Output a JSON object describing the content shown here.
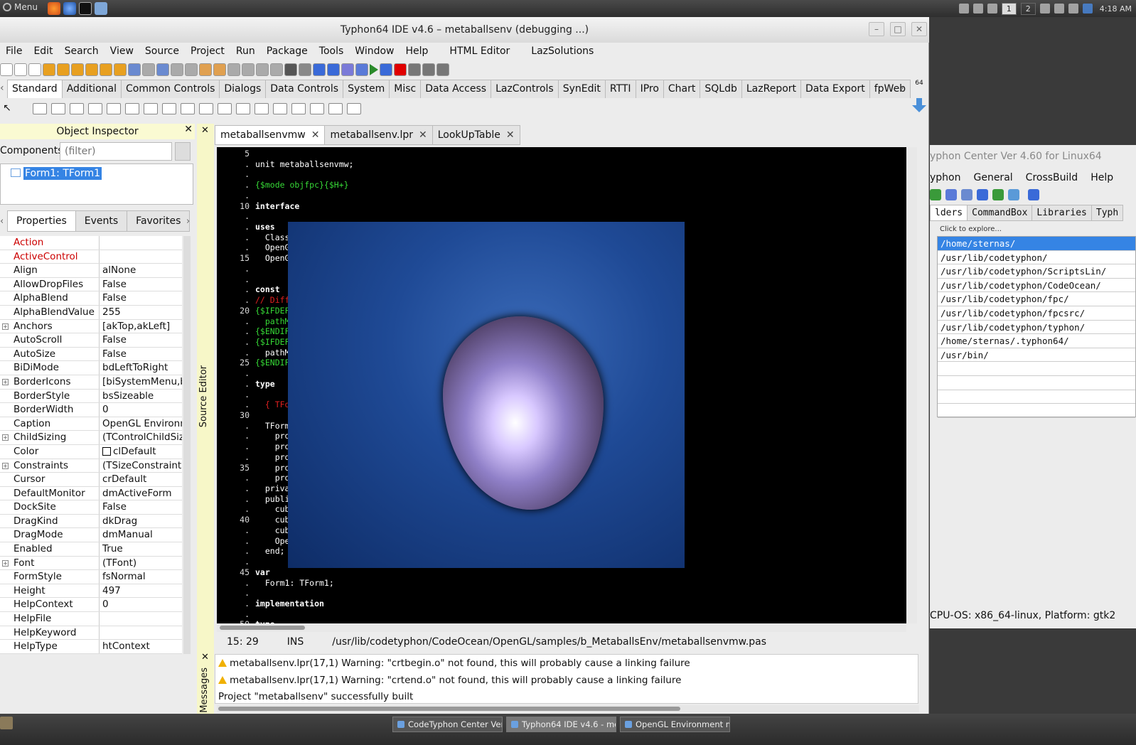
{
  "system_bar": {
    "menu_label": "Menu",
    "workspaces": [
      "1",
      "2"
    ],
    "clock": "4:18 AM"
  },
  "ide": {
    "title": "Typhon64 IDE v4.6 – metaballsenv (debugging ...)",
    "menu": [
      "File",
      "Edit",
      "Search",
      "View",
      "Source",
      "Project",
      "Run",
      "Package",
      "Tools",
      "Window",
      "Help",
      "HTML Editor",
      "LazSolutions"
    ],
    "palette_tabs": [
      "Standard",
      "Additional",
      "Common Controls",
      "Dialogs",
      "Data Controls",
      "System",
      "Misc",
      "Data Access",
      "LazControls",
      "SynEdit",
      "RTTI",
      "IPro",
      "Chart",
      "SQLdb",
      "LazReport",
      "Data Export",
      "fpWeb"
    ],
    "palette_active": "Standard"
  },
  "object_inspector": {
    "title": "Object Inspector",
    "components_label": "Components",
    "filter_placeholder": "(filter)",
    "tree_item": "Form1: TForm1",
    "tabs": [
      "Properties",
      "Events",
      "Favorites"
    ],
    "properties": [
      {
        "key": "Action",
        "value": "",
        "red": true
      },
      {
        "key": "ActiveControl",
        "value": "",
        "red": true
      },
      {
        "key": "Align",
        "value": "alNone"
      },
      {
        "key": "AllowDropFiles",
        "value": "False"
      },
      {
        "key": "AlphaBlend",
        "value": "False"
      },
      {
        "key": "AlphaBlendValue",
        "value": "255"
      },
      {
        "key": "Anchors",
        "value": "[akTop,akLeft]",
        "expand": true
      },
      {
        "key": "AutoScroll",
        "value": "False"
      },
      {
        "key": "AutoSize",
        "value": "False"
      },
      {
        "key": "BiDiMode",
        "value": "bdLeftToRight"
      },
      {
        "key": "BorderIcons",
        "value": "[biSystemMenu,b",
        "expand": true
      },
      {
        "key": "BorderStyle",
        "value": "bsSizeable"
      },
      {
        "key": "BorderWidth",
        "value": "0"
      },
      {
        "key": "Caption",
        "value": "OpenGL Environm"
      },
      {
        "key": "ChildSizing",
        "value": "(TControlChildSiz",
        "expand": true
      },
      {
        "key": "Color",
        "value": "clDefault",
        "swatch": true
      },
      {
        "key": "Constraints",
        "value": "(TSizeConstraints",
        "expand": true
      },
      {
        "key": "Cursor",
        "value": "crDefault"
      },
      {
        "key": "DefaultMonitor",
        "value": "dmActiveForm"
      },
      {
        "key": "DockSite",
        "value": "False"
      },
      {
        "key": "DragKind",
        "value": "dkDrag"
      },
      {
        "key": "DragMode",
        "value": "dmManual"
      },
      {
        "key": "Enabled",
        "value": "True"
      },
      {
        "key": "Font",
        "value": "(TFont)",
        "expand": true
      },
      {
        "key": "FormStyle",
        "value": "fsNormal"
      },
      {
        "key": "Height",
        "value": "497"
      },
      {
        "key": "HelpContext",
        "value": "0"
      },
      {
        "key": "HelpFile",
        "value": ""
      },
      {
        "key": "HelpKeyword",
        "value": ""
      },
      {
        "key": "HelpType",
        "value": "htContext"
      }
    ]
  },
  "source_editor": {
    "strip_label": "Source Editor",
    "tabs": [
      {
        "label": "metaballsenvmw",
        "active": true
      },
      {
        "label": "metaballsenv.lpr",
        "active": false
      },
      {
        "label": "LookUpTable",
        "active": false
      }
    ],
    "line_numbers": [
      "5",
      "10",
      "15",
      "20",
      "25",
      "30",
      "35",
      "40",
      "45",
      "50"
    ],
    "lines": [
      {
        "row": 1,
        "text": "unit metaballsenvmw;",
        "cls": ""
      },
      {
        "row": 3,
        "text": "{$mode objfpc}{$H+}",
        "cls": "cm"
      },
      {
        "row": 5,
        "text": "interface",
        "cls": "kw"
      },
      {
        "row": 7,
        "text": "uses",
        "cls": "kw"
      },
      {
        "row": 8,
        "text": "  Class",
        "cls": ""
      },
      {
        "row": 9,
        "text": "  OpenG",
        "cls": ""
      },
      {
        "row": 10,
        "text": "  OpenG",
        "cls": ""
      },
      {
        "row": 13,
        "text": "const",
        "cls": "kw"
      },
      {
        "row": 14,
        "text": "// Diff",
        "cls": "red"
      },
      {
        "row": 15,
        "text": "{$IFDEF",
        "cls": "cm"
      },
      {
        "row": 16,
        "text": "  pathM",
        "cls": "cm"
      },
      {
        "row": 17,
        "text": "{$ENDIF",
        "cls": "cm"
      },
      {
        "row": 18,
        "text": "{$IFDEF",
        "cls": "cm"
      },
      {
        "row": 19,
        "text": "  pathM",
        "cls": ""
      },
      {
        "row": 20,
        "text": "{$ENDIF",
        "cls": "cm"
      },
      {
        "row": 22,
        "text": "type",
        "cls": "kw"
      },
      {
        "row": 24,
        "text": "  { TFo",
        "cls": "red"
      },
      {
        "row": 26,
        "text": "  TForm",
        "cls": ""
      },
      {
        "row": 27,
        "text": "    pro",
        "cls": ""
      },
      {
        "row": 28,
        "text": "    pro",
        "cls": ""
      },
      {
        "row": 29,
        "text": "    pro",
        "cls": ""
      },
      {
        "row": 30,
        "text": "    pro",
        "cls": ""
      },
      {
        "row": 31,
        "text": "    pro",
        "cls": ""
      },
      {
        "row": 32,
        "text": "  priva",
        "cls": ""
      },
      {
        "row": 33,
        "text": "  publi",
        "cls": ""
      },
      {
        "row": 34,
        "text": "    cub",
        "cls": ""
      },
      {
        "row": 35,
        "text": "    cub",
        "cls": ""
      },
      {
        "row": 36,
        "text": "    cub",
        "cls": ""
      },
      {
        "row": 37,
        "text": "    Ope",
        "cls": ""
      },
      {
        "row": 38,
        "text": "  end;",
        "cls": ""
      },
      {
        "row": 40,
        "text": "var",
        "cls": "kw"
      },
      {
        "row": 41,
        "text": "  Form1: TForm1;",
        "cls": ""
      },
      {
        "row": 43,
        "text": "implementation",
        "cls": "kw"
      },
      {
        "row": 45,
        "text": "type",
        "cls": "kw"
      }
    ],
    "status_pos": "15: 29",
    "status_mode": "INS",
    "status_path": "/usr/lib/codetyphon/CodeOcean/OpenGL/samples/b_MetaballsEnv/metaballsenvmw.pas"
  },
  "messages": {
    "strip_label": "Messages",
    "items": [
      {
        "text": "metaballsenv.lpr(17,1) Warning: \"crtbegin.o\" not found, this will probably cause a linking failure",
        "warn": true
      },
      {
        "text": "metaballsenv.lpr(17,1) Warning: \"crtend.o\" not found, this will probably cause a linking failure",
        "warn": true
      },
      {
        "text": "Project \"metaballsenv\" successfully built",
        "warn": false
      }
    ]
  },
  "codetyphon_center": {
    "title": "yphon Center Ver 4.60 for Linux64",
    "menu": [
      "yphon",
      "General",
      "CrossBuild",
      "Help"
    ],
    "tabs": [
      "lders",
      "CommandBox",
      "Libraries",
      "Typh"
    ],
    "hint": "Click to explore...",
    "folders": [
      "/home/sternas/",
      "/usr/lib/codetyphon/",
      "/usr/lib/codetyphon/ScriptsLin/",
      "/usr/lib/codetyphon/CodeOcean/",
      "/usr/lib/codetyphon/fpc/",
      "/usr/lib/codetyphon/fpcsrc/",
      "/usr/lib/codetyphon/typhon/",
      "/home/sternas/.typhon64/",
      "/usr/bin/"
    ],
    "status": "CPU-OS: x86_64-linux, Platform: gtk2"
  },
  "taskbar": {
    "tasks": [
      {
        "label": "CodeTyphon Center Ver...",
        "active": false
      },
      {
        "label": "Typhon64 IDE v4.6 - me...",
        "active": true
      },
      {
        "label": "OpenGL Environment m...",
        "active": false
      }
    ]
  },
  "colors": {
    "selection": "#3584e4",
    "comment_green": "#36d836",
    "comment_red": "#e02020",
    "panel_header": "#fafad2"
  }
}
